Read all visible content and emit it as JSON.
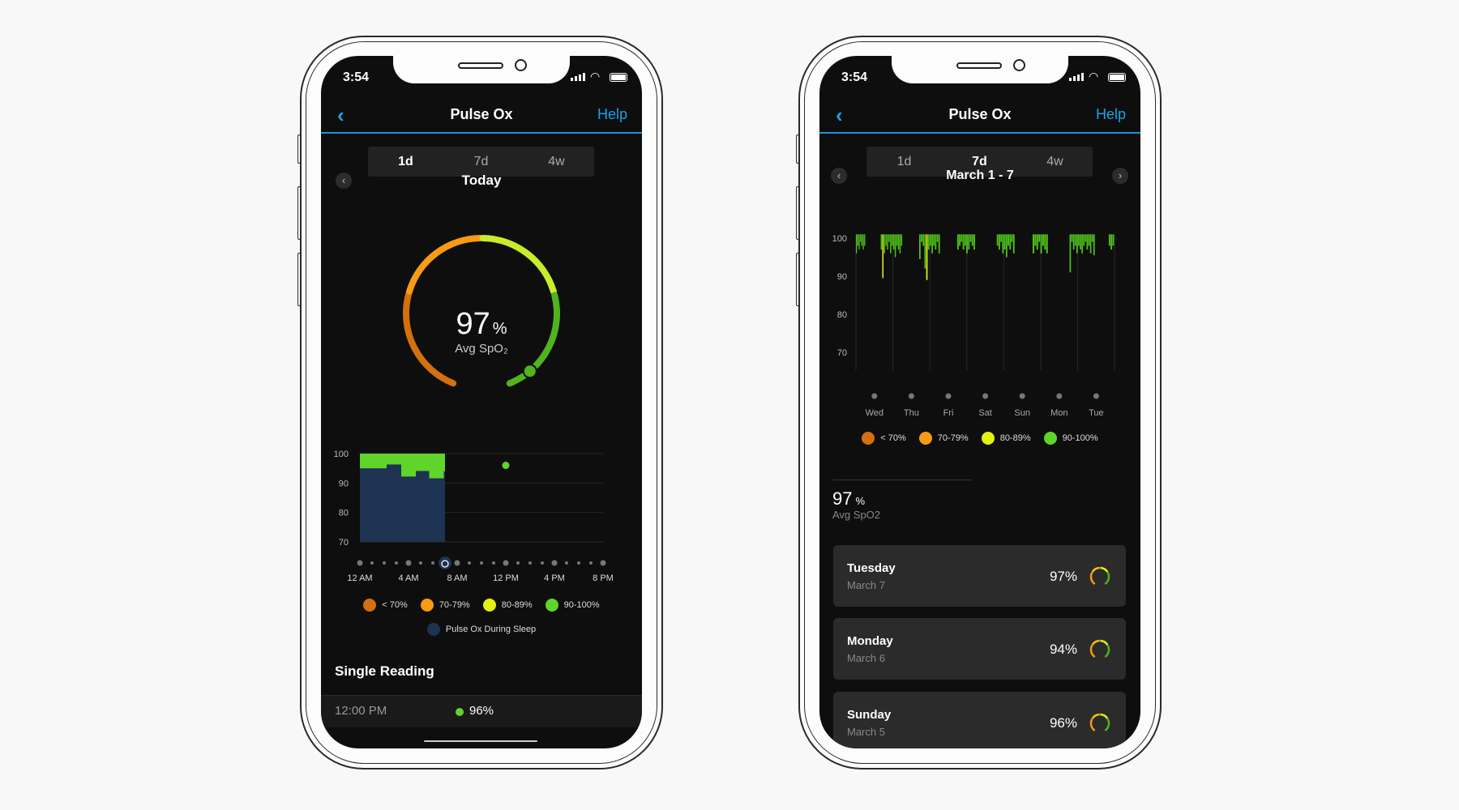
{
  "colors": {
    "accent": "#1aa3e8",
    "lt70": "#d4700e",
    "r70_79": "#f79a14",
    "r80_89": "#e4f012",
    "r90_100": "#5fd42a",
    "sleep": "#1e3352"
  },
  "status": {
    "time": "3:54"
  },
  "left": {
    "header": {
      "title": "Pulse Ox",
      "help": "Help",
      "back_icon": "chevron-left-icon"
    },
    "tabs": [
      {
        "label": "1d",
        "active": true
      },
      {
        "label": "7d",
        "active": false
      },
      {
        "label": "4w",
        "active": false
      }
    ],
    "period": "Today",
    "gauge": {
      "value": "97",
      "unit": "%",
      "label": "Avg SpO₂",
      "value_num": 97
    },
    "legend": [
      {
        "label": "< 70%"
      },
      {
        "label": "70-79%"
      },
      {
        "label": "80-89%"
      },
      {
        "label": "90-100%"
      }
    ],
    "sleep_legend": "Pulse Ox During Sleep",
    "single_reading": {
      "title": "Single Reading",
      "time": "12:00 PM",
      "value": "96%"
    }
  },
  "right": {
    "header": {
      "title": "Pulse Ox",
      "help": "Help"
    },
    "tabs": [
      {
        "label": "1d",
        "active": false
      },
      {
        "label": "7d",
        "active": true
      },
      {
        "label": "4w",
        "active": false
      }
    ],
    "period": "March 1 - 7",
    "legend": [
      {
        "label": "< 70%"
      },
      {
        "label": "70-79%"
      },
      {
        "label": "80-89%"
      },
      {
        "label": "90-100%"
      }
    ],
    "summary": {
      "value": "97",
      "unit": "%",
      "label": "Avg SpO2"
    },
    "days": [
      {
        "day": "Tuesday",
        "date": "March 7",
        "value": "97%"
      },
      {
        "day": "Monday",
        "date": "March 6",
        "value": "94%"
      },
      {
        "day": "Sunday",
        "date": "March 5",
        "value": "96%"
      }
    ]
  },
  "chart_data": [
    {
      "type": "area",
      "ylim": [
        70,
        100
      ],
      "yticks": [
        "100",
        "90",
        "80",
        "70"
      ],
      "xticks": [
        "12 AM",
        "4 AM",
        "8 AM",
        "12 PM",
        "4 PM",
        "8 PM"
      ],
      "xrange_hours": [
        0,
        20
      ],
      "sleep": {
        "start_hour": 0,
        "end_hour": 7,
        "steps": [
          {
            "from": 0,
            "to": 2.2,
            "min": 95
          },
          {
            "from": 2.2,
            "to": 3.4,
            "min": 96.3
          },
          {
            "from": 3.4,
            "to": 4.6,
            "min": 92.2
          },
          {
            "from": 4.6,
            "to": 5.7,
            "min": 94.1
          },
          {
            "from": 5.7,
            "to": 6.9,
            "min": 91.6
          },
          {
            "from": 6.9,
            "to": 7,
            "min": 94
          }
        ]
      },
      "points": [
        {
          "hour": 12,
          "value": 96
        }
      ],
      "alarm_hour": 7
    },
    {
      "type": "bar",
      "ylim": [
        70,
        101
      ],
      "yticks": [
        "100",
        "90",
        "80",
        "70"
      ],
      "categories": [
        "Wed",
        "Thu",
        "Fri",
        "Sat",
        "Sun",
        "Mon",
        "Tue"
      ],
      "nights": [
        {
          "from": 0.0,
          "to": 0.26,
          "mins": [
            96,
            98,
            97,
            99,
            98,
            97,
            98
          ]
        },
        {
          "from": 0.67,
          "to": 1.26,
          "mins": [
            97,
            89.5,
            96,
            98,
            97,
            99,
            96,
            98,
            97,
            95,
            98,
            97,
            96,
            98
          ]
        },
        {
          "from": 1.71,
          "to": 2.28,
          "mins": [
            94.5,
            99,
            98,
            92,
            89,
            97,
            98,
            96,
            98,
            97,
            99,
            96
          ]
        },
        {
          "from": 2.74,
          "to": 3.23,
          "mins": [
            97,
            98,
            99,
            97,
            98,
            96,
            97,
            99,
            98,
            97
          ]
        },
        {
          "from": 3.81,
          "to": 4.3,
          "mins": [
            98,
            97,
            99,
            96,
            97,
            95,
            98,
            97,
            99,
            96
          ]
        },
        {
          "from": 4.78,
          "to": 5.2,
          "mins": [
            96,
            98,
            97,
            99,
            96,
            98,
            97,
            96
          ]
        },
        {
          "from": 5.78,
          "to": 6.47,
          "mins": [
            91,
            99,
            97,
            98,
            96,
            98,
            97,
            96,
            98,
            99,
            97,
            98,
            96,
            99,
            95.5
          ]
        },
        {
          "from": 6.84,
          "to": 6.99,
          "mins": [
            98,
            97,
            98
          ]
        }
      ]
    }
  ]
}
